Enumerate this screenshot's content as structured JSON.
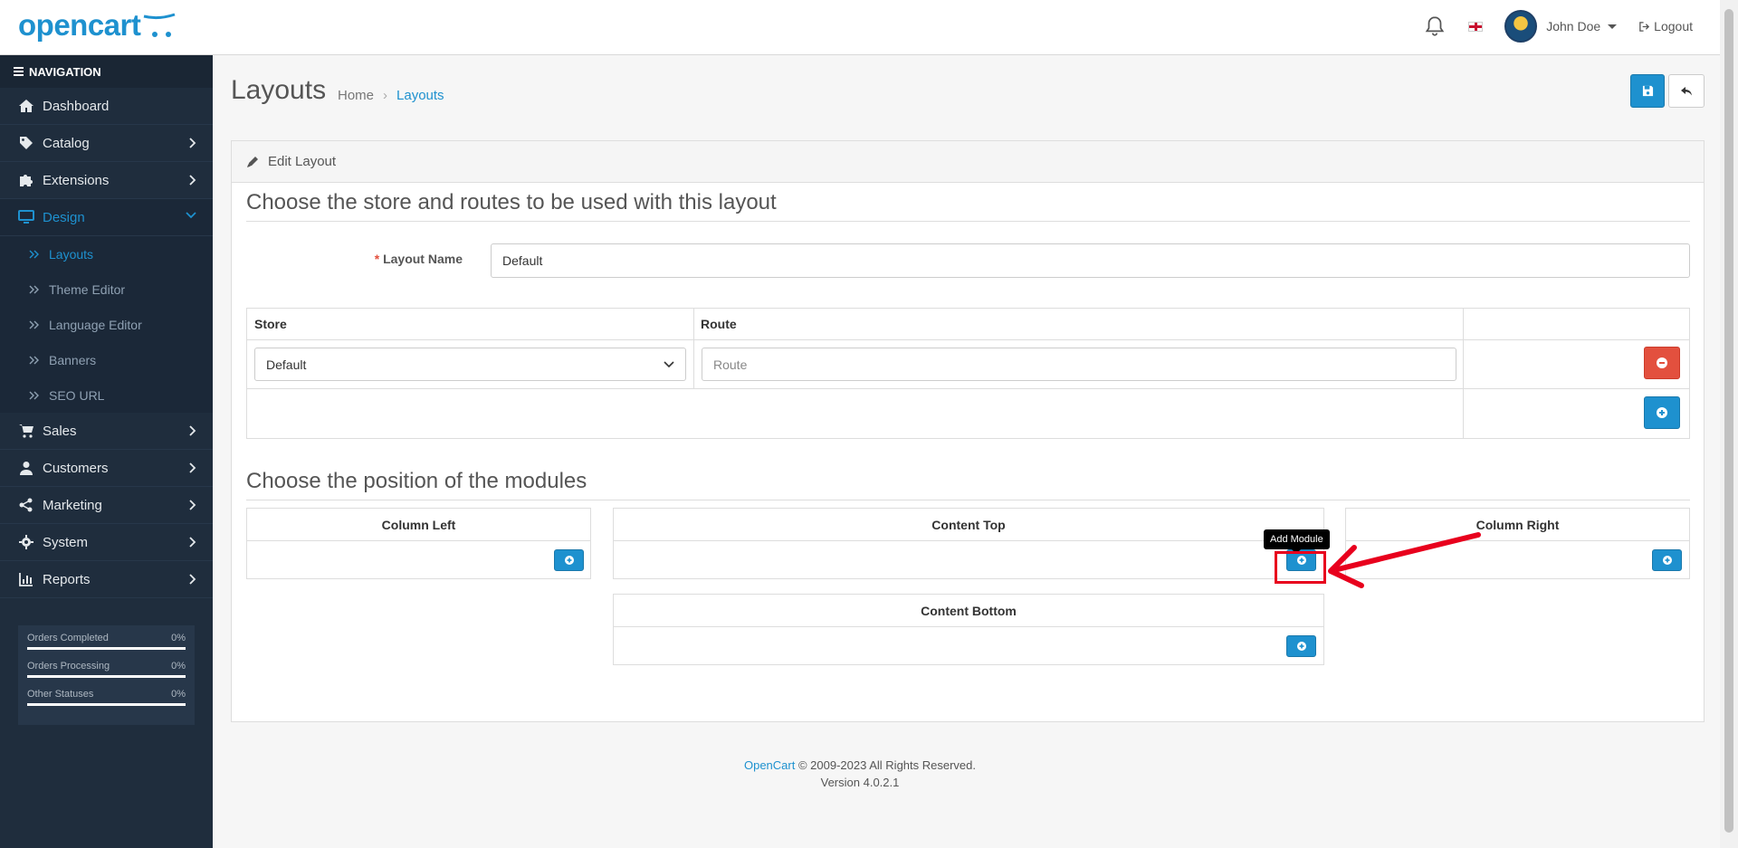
{
  "header": {
    "logo_text": "opencart",
    "user_name": "John Doe",
    "logout_label": "Logout"
  },
  "sidebar": {
    "nav_title": "NAVIGATION",
    "items": [
      {
        "label": "Dashboard",
        "icon": "home-icon"
      },
      {
        "label": "Catalog",
        "icon": "tag-icon"
      },
      {
        "label": "Extensions",
        "icon": "puzzle-icon"
      },
      {
        "label": "Design",
        "icon": "monitor-icon"
      },
      {
        "label": "Sales",
        "icon": "cart-icon"
      },
      {
        "label": "Customers",
        "icon": "user-icon"
      },
      {
        "label": "Marketing",
        "icon": "share-icon"
      },
      {
        "label": "System",
        "icon": "gear-icon"
      },
      {
        "label": "Reports",
        "icon": "bar-chart-icon"
      }
    ],
    "design_sub": [
      {
        "label": "Layouts"
      },
      {
        "label": "Theme Editor"
      },
      {
        "label": "Language Editor"
      },
      {
        "label": "Banners"
      },
      {
        "label": "SEO URL"
      }
    ],
    "stats": [
      {
        "label": "Orders Completed",
        "value": "0%"
      },
      {
        "label": "Orders Processing",
        "value": "0%"
      },
      {
        "label": "Other Statuses",
        "value": "0%"
      }
    ]
  },
  "page": {
    "title": "Layouts",
    "breadcrumb_home": "Home",
    "breadcrumb_current": "Layouts"
  },
  "card": {
    "heading": "Edit Layout",
    "section1_title": "Choose the store and routes to be used with this layout",
    "layout_name_label": "Layout Name",
    "layout_name_value": "Default",
    "table_store_header": "Store",
    "table_route_header": "Route",
    "store_value": "Default",
    "route_placeholder": "Route",
    "section2_title": "Choose the position of the modules",
    "column_left": "Column Left",
    "content_top": "Content Top",
    "column_right": "Column Right",
    "content_bottom": "Content Bottom",
    "tooltip": "Add Module"
  },
  "footer": {
    "link": "OpenCart",
    "copyright": "© 2009-2023 All Rights Reserved.",
    "version": "Version 4.0.2.1"
  },
  "colors": {
    "brand": "#1e91cf",
    "sidebar_bg": "#1f2d3d",
    "danger": "#e3503e",
    "annotation": "#e8001d"
  }
}
